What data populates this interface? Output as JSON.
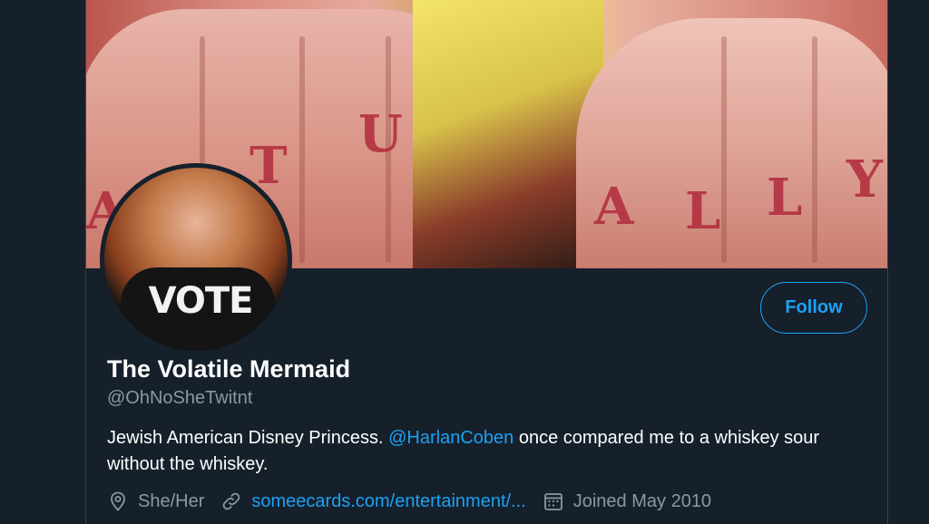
{
  "banner": {
    "tattoo_left": [
      "A",
      "T",
      "U"
    ],
    "tattoo_right": [
      "A",
      "L",
      "L",
      "Y"
    ]
  },
  "avatar": {
    "shirt_text": "VOTE"
  },
  "follow_button": {
    "label": "Follow"
  },
  "profile": {
    "display_name": "The Volatile Mermaid",
    "handle": "@OhNoSheTwitnt"
  },
  "bio": {
    "text_before": "Jewish American Disney Princess. ",
    "mention": "@HarlanCoben",
    "text_after": " once compared me to a whiskey sour without the whiskey."
  },
  "meta": {
    "location": "She/Her",
    "link": "someecards.com/entertainment/...",
    "joined": "Joined May 2010"
  },
  "icons": {
    "location": "location-pin-icon",
    "link": "link-icon",
    "joined": "calendar-icon"
  },
  "colors": {
    "background": "#15202b",
    "accent": "#1da1f2",
    "secondary_text": "#8899a6"
  }
}
